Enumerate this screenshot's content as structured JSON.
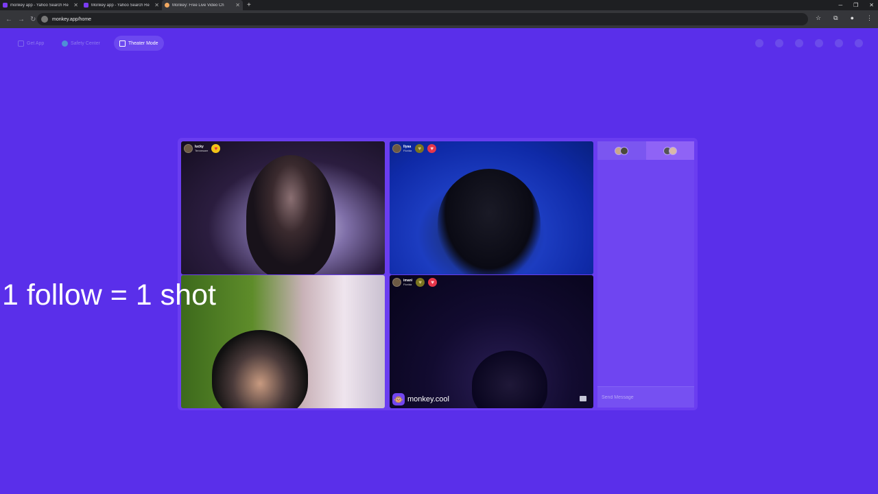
{
  "browser": {
    "tabs": [
      {
        "title": "monkey app - Yahoo Search Re",
        "favicon": "yahoo-favicon",
        "active": false
      },
      {
        "title": "Monkey app - Yahoo Search Re",
        "favicon": "yahoo-favicon",
        "active": false
      },
      {
        "title": "Monkey: Free Live Video Ch",
        "favicon": "monkey-favicon",
        "active": true
      }
    ],
    "new_tab": "+",
    "url": "monkey.app/home"
  },
  "toolbar": {
    "get_app": "Get App",
    "safety_center": "Safety Center",
    "theater_mode": "Theater Mode"
  },
  "overlay_text": "1 follow = 1 shot",
  "tiles": [
    {
      "name": "lucky",
      "location": "Tennessee",
      "badges": [
        "gold"
      ]
    },
    {
      "name": "llyaa",
      "location": "Florida",
      "badges": [
        "olive",
        "red"
      ]
    },
    {
      "name": "",
      "location": "",
      "badges": []
    },
    {
      "name": "imani",
      "location": "Florida",
      "badges": [
        "olive",
        "red"
      ]
    }
  ],
  "brand": {
    "text": "monkey.cool",
    "logo": "monkey-icon"
  },
  "side_panel": {
    "message_placeholder": "Send Message"
  },
  "colors": {
    "background": "#5a2fea",
    "panel": "#6f45f1",
    "accent_gold": "#f2c318",
    "accent_red": "#e5364a"
  }
}
